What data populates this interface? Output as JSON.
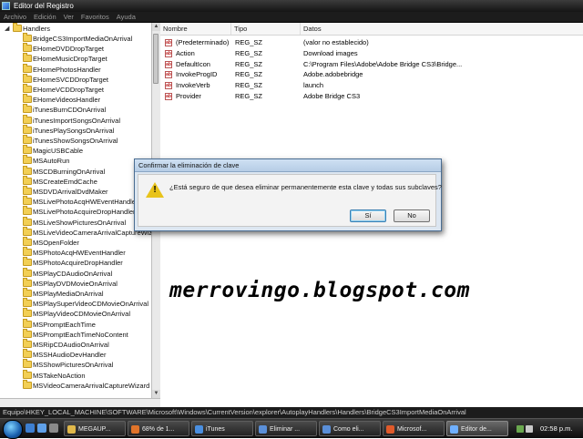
{
  "window": {
    "title": "Editor del Registro"
  },
  "menu": [
    "Archivo",
    "Edición",
    "Ver",
    "Favoritos",
    "Ayuda"
  ],
  "tree": {
    "root": "Handlers",
    "items": [
      "BridgeCS3ImportMediaOnArrival",
      "EHomeDVDDropTarget",
      "EHomeMusicDropTarget",
      "EHomePhotosHandler",
      "EHomeSVCDDropTarget",
      "EHomeVCDDropTarget",
      "EHomeVideosHandler",
      "iTunesBurnCDOnArrival",
      "iTunesImportSongsOnArrival",
      "iTunesPlaySongsOnArrival",
      "iTunesShowSongsOnArrival",
      "MagicUSBCable",
      "MSAutoRun",
      "MSCDBurningOnArrival",
      "MSCreateEmdCache",
      "MSDVDArrivalDvdMaker",
      "MSLivePhotoAcqHWEventHandler",
      "MSLivePhotoAcquireDropHandler",
      "MSLiveShowPicturesOnArrival",
      "MSLiveVideoCameraArrivalCaptureWiz",
      "MSOpenFolder",
      "MSPhotoAcqHWEventHandler",
      "MSPhotoAcquireDropHandler",
      "MSPlayCDAudioOnArrival",
      "MSPlayDVDMovieOnArrival",
      "MSPlayMediaOnArrival",
      "MSPlaySuperVideoCDMovieOnArrival",
      "MSPlayVideoCDMovieOnArrival",
      "MSPromptEachTime",
      "MSPromptEachTimeNoContent",
      "MSRipCDAudioOnArrival",
      "MSSHAudioDevHandler",
      "MSShowPicturesOnArrival",
      "MSTakeNoAction",
      "MSVideoCameraArrivalCaptureWizard"
    ]
  },
  "values": {
    "headers": {
      "name": "Nombre",
      "type": "Tipo",
      "data": "Datos"
    },
    "rows": [
      {
        "name": "(Predeterminado)",
        "type": "REG_SZ",
        "data": "(valor no establecido)"
      },
      {
        "name": "Action",
        "type": "REG_SZ",
        "data": "Download images"
      },
      {
        "name": "DefaultIcon",
        "type": "REG_SZ",
        "data": "C:\\Program Files\\Adobe\\Adobe Bridge CS3\\Bridge..."
      },
      {
        "name": "InvokeProgID",
        "type": "REG_SZ",
        "data": "Adobe.adobebridge"
      },
      {
        "name": "InvokeVerb",
        "type": "REG_SZ",
        "data": "launch"
      },
      {
        "name": "Provider",
        "type": "REG_SZ",
        "data": "Adobe Bridge CS3"
      }
    ],
    "icon_text": "ab"
  },
  "dialog": {
    "title": "Confirmar la eliminación de clave",
    "message": "¿Está seguro de que desea eliminar permanentemente esta clave y todas sus subclaves?",
    "warning_glyph": "!",
    "yes_label": "Sí",
    "no_label": "No"
  },
  "watermark": "merrovingo.blogspot.com",
  "status_path": "Equipo\\HKEY_LOCAL_MACHINE\\SOFTWARE\\Microsoft\\Windows\\CurrentVersion\\explorer\\AutoplayHandlers\\Handlers\\BridgeCS3ImportMediaOnArrival",
  "taskbar": {
    "items": [
      {
        "label": "MEGAUP...",
        "icon": "folder-icon",
        "color": "#e0b84a"
      },
      {
        "label": "68% de 1...",
        "icon": "firefox-icon",
        "color": "#e0742a"
      },
      {
        "label": "iTunes",
        "icon": "itunes-icon",
        "color": "#4a8fe0"
      },
      {
        "label": "Eliminar ...",
        "icon": "ie-icon",
        "color": "#5a8fd8"
      },
      {
        "label": "Como eli...",
        "icon": "ie-icon",
        "color": "#5a8fd8"
      },
      {
        "label": "Microsof...",
        "icon": "office-icon",
        "color": "#e05a2a"
      },
      {
        "label": "Editor de...",
        "icon": "regedit-icon",
        "color": "#6fb0ff"
      }
    ],
    "clock": "02:58 p.m."
  }
}
